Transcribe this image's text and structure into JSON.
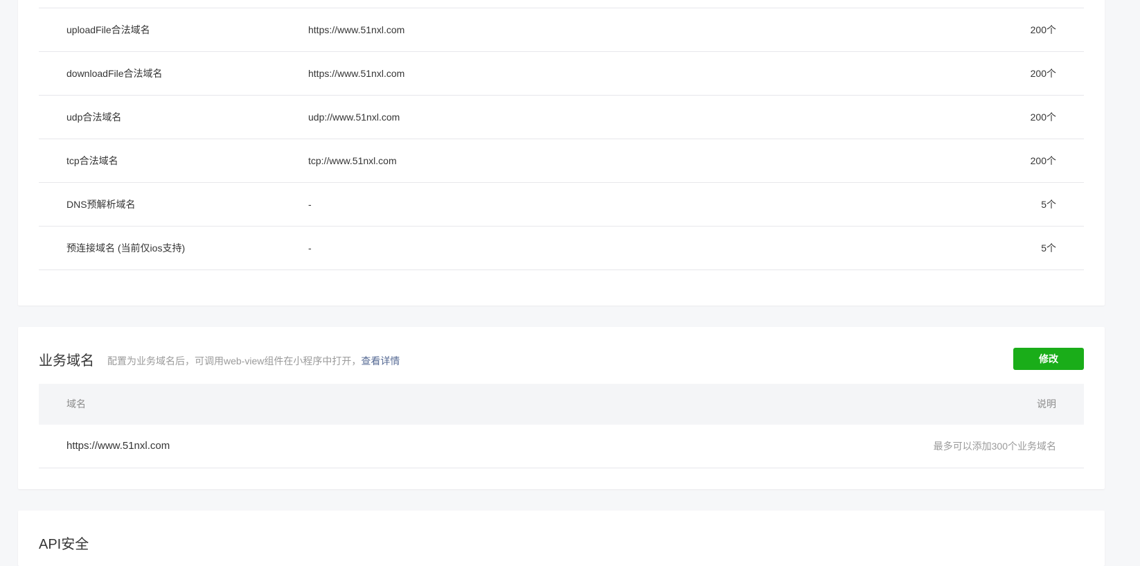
{
  "server_domains": {
    "rows": [
      {
        "name": "uploadFile合法域名",
        "value": "https://www.51nxl.com",
        "limit": "200个"
      },
      {
        "name": "downloadFile合法域名",
        "value": "https://www.51nxl.com",
        "limit": "200个"
      },
      {
        "name": "udp合法域名",
        "value": "udp://www.51nxl.com",
        "limit": "200个"
      },
      {
        "name": "tcp合法域名",
        "value": "tcp://www.51nxl.com",
        "limit": "200个"
      },
      {
        "name": "DNS预解析域名",
        "value": "-",
        "limit": "5个"
      },
      {
        "name": "预连接域名 (当前仅ios支持)",
        "value": "-",
        "limit": "5个"
      }
    ]
  },
  "business_domain": {
    "title": "业务域名",
    "desc": "配置为业务域名后，可调用web-view组件在小程序中打开，",
    "link": "查看详情",
    "button": "修改",
    "header_domain": "域名",
    "header_desc": "说明",
    "row": {
      "domain": "https://www.51nxl.com",
      "note": "最多可以添加300个业务域名"
    }
  },
  "api_security": {
    "title": "API安全"
  },
  "colors": {
    "button_green": "#1aad19",
    "link_blue": "#576b95"
  }
}
